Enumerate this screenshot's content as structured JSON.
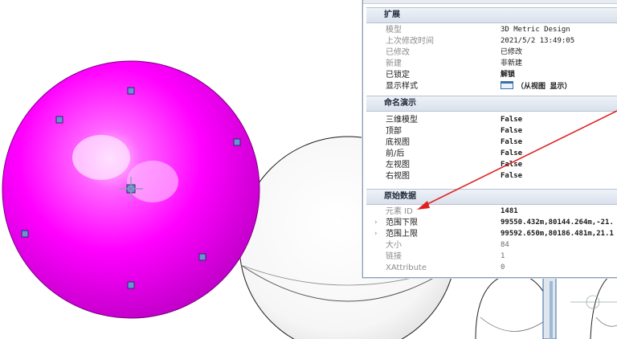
{
  "properties": {
    "sections": {
      "extension": "扩展",
      "named_presentation": "命名演示",
      "raw_data": "原始数据"
    },
    "extension_rows": [
      {
        "label": "模型",
        "value": "3D Metric Design"
      },
      {
        "label": "上次修改时间",
        "value": "2021/5/2 13:49:05"
      },
      {
        "label": "已修改",
        "value": "已修改"
      },
      {
        "label": "新建",
        "value": "非新建"
      },
      {
        "label": "已锁定",
        "value": "解锁"
      },
      {
        "label": "显示样式",
        "value": "（从视图 显示）"
      }
    ],
    "named_rows": [
      {
        "label": "三维模型",
        "value": "False"
      },
      {
        "label": "顶部",
        "value": "False"
      },
      {
        "label": "底视图",
        "value": "False"
      },
      {
        "label": "前/后",
        "value": "False"
      },
      {
        "label": "左视图",
        "value": "False"
      },
      {
        "label": "右视图",
        "value": "False"
      }
    ],
    "raw_rows": [
      {
        "label": "元素 ID",
        "value": "1481"
      },
      {
        "label": "范围下限",
        "value": "99550.432m,80144.264m,-21."
      },
      {
        "label": "范围上限",
        "value": "99592.650m,80186.481m,21.1"
      },
      {
        "label": "大小",
        "value": "84"
      },
      {
        "label": "链接",
        "value": "1"
      },
      {
        "label": "XAttribute",
        "value": "0"
      }
    ]
  },
  "colors": {
    "selected_sphere": "#ff00ff",
    "annotation_arrow": "#e02020",
    "handle": "#5b7fc6"
  },
  "icons": {
    "display_style": "window-icon",
    "expand": "chevron-right-icon"
  }
}
